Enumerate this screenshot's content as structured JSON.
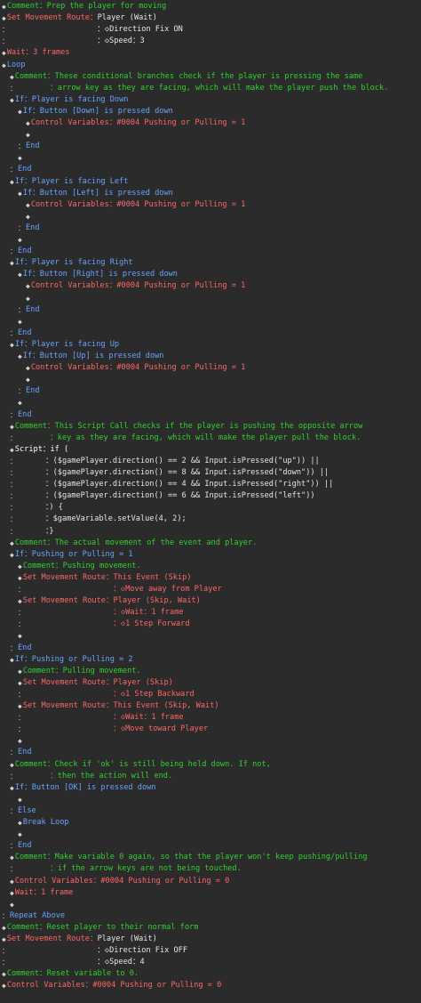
{
  "colors": {
    "background": "#2b2b2b",
    "comment": "#2fd12f",
    "command": "#ff6666",
    "flow": "#66a3ff",
    "plain": "#e6e6e6"
  },
  "lines": [
    {
      "ind": 0,
      "m": "◆",
      "k": "comment",
      "t": "Comment：Prep the player for moving"
    },
    {
      "ind": 0,
      "m": "◆",
      "k": "move",
      "t": "Set Movement Route：",
      "r": "Player (Wait)"
    },
    {
      "ind": 0,
      "m": "：",
      "k": "plain",
      "t": "                   ：◇Direction Fix ON"
    },
    {
      "ind": 0,
      "m": "：",
      "k": "plain",
      "t": "                   ：◇Speed：3"
    },
    {
      "ind": 0,
      "m": "◆",
      "k": "wait",
      "t": "Wait：3 frames"
    },
    {
      "ind": 0,
      "m": "◆",
      "k": "flow",
      "t": "Loop"
    },
    {
      "ind": 1,
      "m": "◆",
      "k": "comment",
      "t": "Comment：These conditional branches check if the player is pressing the same"
    },
    {
      "ind": 1,
      "m": "：",
      "k": "comment",
      "t": "       ：arrow key as they are facing, which will make the player push the block."
    },
    {
      "ind": 1,
      "m": "◆",
      "k": "flow",
      "t": "If：Player is facing Down"
    },
    {
      "ind": 2,
      "m": "◆",
      "k": "flow",
      "t": "If：Button [Down] is pressed down"
    },
    {
      "ind": 3,
      "m": "◆",
      "k": "var",
      "t": "Control Variables：#0004 Pushing or Pulling = 1"
    },
    {
      "ind": 3,
      "m": "◆",
      "k": "plain",
      "t": ""
    },
    {
      "ind": 2,
      "m": "：",
      "k": "flow",
      "t": "End"
    },
    {
      "ind": 2,
      "m": "◆",
      "k": "plain",
      "t": ""
    },
    {
      "ind": 1,
      "m": "：",
      "k": "flow",
      "t": "End"
    },
    {
      "ind": 1,
      "m": "◆",
      "k": "flow",
      "t": "If：Player is facing Left"
    },
    {
      "ind": 2,
      "m": "◆",
      "k": "flow",
      "t": "If：Button [Left] is pressed down"
    },
    {
      "ind": 3,
      "m": "◆",
      "k": "var",
      "t": "Control Variables：#0004 Pushing or Pulling = 1"
    },
    {
      "ind": 3,
      "m": "◆",
      "k": "plain",
      "t": ""
    },
    {
      "ind": 2,
      "m": "：",
      "k": "flow",
      "t": "End"
    },
    {
      "ind": 2,
      "m": "◆",
      "k": "plain",
      "t": ""
    },
    {
      "ind": 1,
      "m": "：",
      "k": "flow",
      "t": "End"
    },
    {
      "ind": 1,
      "m": "◆",
      "k": "flow",
      "t": "If：Player is facing Right"
    },
    {
      "ind": 2,
      "m": "◆",
      "k": "flow",
      "t": "If：Button [Right] is pressed down"
    },
    {
      "ind": 3,
      "m": "◆",
      "k": "var",
      "t": "Control Variables：#0004 Pushing or Pulling = 1"
    },
    {
      "ind": 3,
      "m": "◆",
      "k": "plain",
      "t": ""
    },
    {
      "ind": 2,
      "m": "：",
      "k": "flow",
      "t": "End"
    },
    {
      "ind": 2,
      "m": "◆",
      "k": "plain",
      "t": ""
    },
    {
      "ind": 1,
      "m": "：",
      "k": "flow",
      "t": "End"
    },
    {
      "ind": 1,
      "m": "◆",
      "k": "flow",
      "t": "If：Player is facing Up"
    },
    {
      "ind": 2,
      "m": "◆",
      "k": "flow",
      "t": "If：Button [Up] is pressed down"
    },
    {
      "ind": 3,
      "m": "◆",
      "k": "var",
      "t": "Control Variables：#0004 Pushing or Pulling = 1"
    },
    {
      "ind": 3,
      "m": "◆",
      "k": "plain",
      "t": ""
    },
    {
      "ind": 2,
      "m": "：",
      "k": "flow",
      "t": "End"
    },
    {
      "ind": 2,
      "m": "◆",
      "k": "plain",
      "t": ""
    },
    {
      "ind": 1,
      "m": "：",
      "k": "flow",
      "t": "End"
    },
    {
      "ind": 1,
      "m": "◆",
      "k": "comment",
      "t": "Comment：This Script Call checks if the player is pushing the opposite arrow"
    },
    {
      "ind": 1,
      "m": "：",
      "k": "comment",
      "t": "       ：key as they are facing, which will make the player pull the block."
    },
    {
      "ind": 1,
      "m": "◆",
      "k": "script",
      "t": "Script：if ("
    },
    {
      "ind": 1,
      "m": "：",
      "k": "plain",
      "t": "      ：($gamePlayer.direction() == 2 && Input.isPressed(\"up\")) ||"
    },
    {
      "ind": 1,
      "m": "：",
      "k": "plain",
      "t": "      ：($gamePlayer.direction() == 8 && Input.isPressed(\"down\")) ||"
    },
    {
      "ind": 1,
      "m": "：",
      "k": "plain",
      "t": "      ：($gamePlayer.direction() == 4 && Input.isPressed(\"right\")) ||"
    },
    {
      "ind": 1,
      "m": "：",
      "k": "plain",
      "t": "      ：($gamePlayer.direction() == 6 && Input.isPressed(\"left\"))"
    },
    {
      "ind": 1,
      "m": "：",
      "k": "plain",
      "t": "      ：) {"
    },
    {
      "ind": 1,
      "m": "：",
      "k": "plain",
      "t": "      ：$gameVariable.setValue(4, 2);"
    },
    {
      "ind": 1,
      "m": "：",
      "k": "plain",
      "t": "      ：}"
    },
    {
      "ind": 1,
      "m": "◆",
      "k": "comment",
      "t": "Comment：The actual movement of the event and player."
    },
    {
      "ind": 1,
      "m": "◆",
      "k": "flow",
      "t": "If：Pushing or Pulling = 1"
    },
    {
      "ind": 2,
      "m": "◆",
      "k": "comment",
      "t": "Comment：Pushing movement."
    },
    {
      "ind": 2,
      "m": "◆",
      "k": "move2",
      "t": "Set Movement Route：This Event (Skip)"
    },
    {
      "ind": 2,
      "m": "：",
      "k": "move2",
      "t": "                   ：◇Move away from Player"
    },
    {
      "ind": 2,
      "m": "◆",
      "k": "move2",
      "t": "Set Movement Route：Player (Skip, Wait)"
    },
    {
      "ind": 2,
      "m": "：",
      "k": "move2",
      "t": "                   ：◇Wait：1 frame"
    },
    {
      "ind": 2,
      "m": "：",
      "k": "move2",
      "t": "                   ：◇1 Step Forward"
    },
    {
      "ind": 2,
      "m": "◆",
      "k": "plain",
      "t": ""
    },
    {
      "ind": 1,
      "m": "：",
      "k": "flow",
      "t": "End"
    },
    {
      "ind": 1,
      "m": "◆",
      "k": "flow",
      "t": "If：Pushing or Pulling = 2"
    },
    {
      "ind": 2,
      "m": "◆",
      "k": "comment",
      "t": "Comment：Pulling movement."
    },
    {
      "ind": 2,
      "m": "◆",
      "k": "move2",
      "t": "Set Movement Route：Player (Skip)"
    },
    {
      "ind": 2,
      "m": "：",
      "k": "move2",
      "t": "                   ：◇1 Step Backward"
    },
    {
      "ind": 2,
      "m": "◆",
      "k": "move2",
      "t": "Set Movement Route：This Event (Skip, Wait)"
    },
    {
      "ind": 2,
      "m": "：",
      "k": "move2",
      "t": "                   ：◇Wait：1 frame"
    },
    {
      "ind": 2,
      "m": "：",
      "k": "move2",
      "t": "                   ：◇Move toward Player"
    },
    {
      "ind": 2,
      "m": "◆",
      "k": "plain",
      "t": ""
    },
    {
      "ind": 1,
      "m": "：",
      "k": "flow",
      "t": "End"
    },
    {
      "ind": 1,
      "m": "◆",
      "k": "comment",
      "t": "Comment：Check if 'ok' is still being held down. If not,"
    },
    {
      "ind": 1,
      "m": "：",
      "k": "comment",
      "t": "       ：then the action will end."
    },
    {
      "ind": 1,
      "m": "◆",
      "k": "flow",
      "t": "If：Button [OK] is pressed down"
    },
    {
      "ind": 2,
      "m": "◆",
      "k": "plain",
      "t": ""
    },
    {
      "ind": 1,
      "m": "：",
      "k": "flow",
      "t": "Else"
    },
    {
      "ind": 2,
      "m": "◆",
      "k": "break",
      "t": "Break Loop"
    },
    {
      "ind": 2,
      "m": "◆",
      "k": "plain",
      "t": ""
    },
    {
      "ind": 1,
      "m": "：",
      "k": "flow",
      "t": "End"
    },
    {
      "ind": 1,
      "m": "◆",
      "k": "comment",
      "t": "Comment：Make variable 0 again, so that the player won't keep pushing/pulling"
    },
    {
      "ind": 1,
      "m": "：",
      "k": "comment",
      "t": "       ：if the arrow keys are not being touched."
    },
    {
      "ind": 1,
      "m": "◆",
      "k": "var",
      "t": "Control Variables：#0004 Pushing or Pulling = 0"
    },
    {
      "ind": 1,
      "m": "◆",
      "k": "wait",
      "t": "Wait：1 frame"
    },
    {
      "ind": 1,
      "m": "◆",
      "k": "plain",
      "t": ""
    },
    {
      "ind": 0,
      "m": "：",
      "k": "flow",
      "t": "Repeat Above"
    },
    {
      "ind": 0,
      "m": "◆",
      "k": "comment",
      "t": "Comment：Reset player to their normal form"
    },
    {
      "ind": 0,
      "m": "◆",
      "k": "move",
      "t": "Set Movement Route：",
      "r": "Player (Wait)"
    },
    {
      "ind": 0,
      "m": "：",
      "k": "plain",
      "t": "                   ：◇Direction Fix OFF"
    },
    {
      "ind": 0,
      "m": "：",
      "k": "plain",
      "t": "                   ：◇Speed：4"
    },
    {
      "ind": 0,
      "m": "◆",
      "k": "comment",
      "t": "Comment：Reset variable to 0."
    },
    {
      "ind": 0,
      "m": "◆",
      "k": "var",
      "t": "Control Variables：#0004 Pushing or Pulling = 0"
    }
  ]
}
